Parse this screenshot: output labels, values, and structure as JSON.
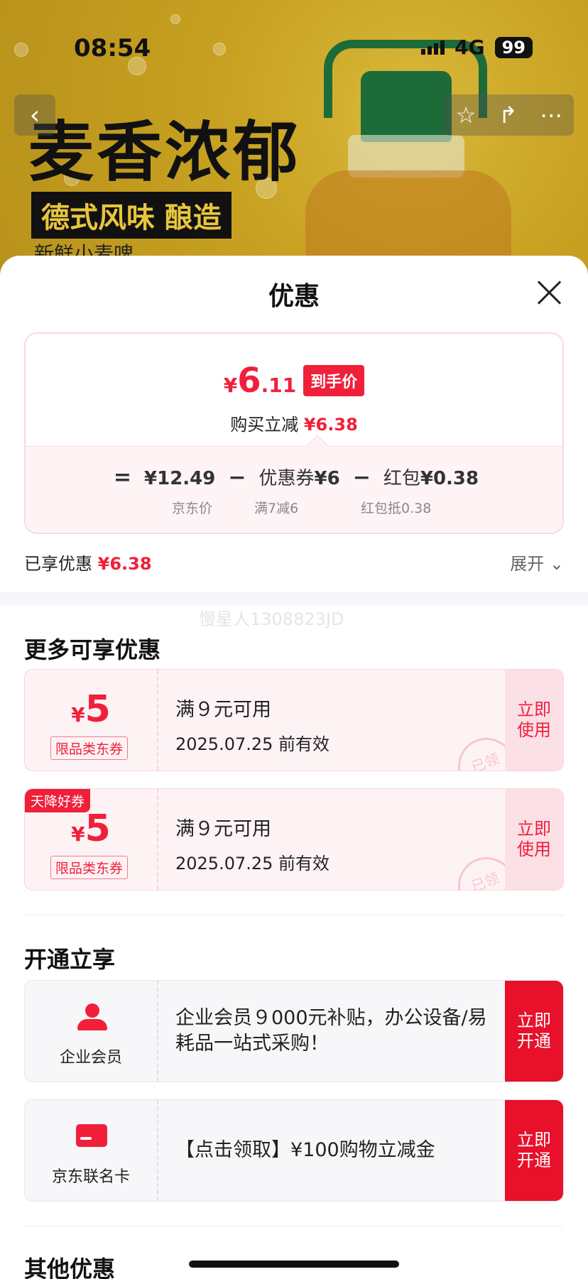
{
  "status_bar": {
    "time": "08:54",
    "network": "4G",
    "battery": "99"
  },
  "hero": {
    "title": "麦香浓郁",
    "subtitle": "德式风味 酿造",
    "subtitle2": "新鲜小麦啤"
  },
  "sheet": {
    "title": "优惠",
    "price_card": {
      "currency": "¥",
      "price_int": "6",
      "price_dec": ".11",
      "price_badge": "到手价",
      "desc_prefix": "购买立减",
      "desc_value": "¥6.38",
      "eq": "=",
      "jd_price": "¥12.49",
      "minus1": "−",
      "coupon_label": "优惠券",
      "coupon_value": "¥6",
      "minus2": "−",
      "redpacket_label": "红包",
      "redpacket_value": "¥0.38",
      "jd_price_note": "京东价",
      "coupon_note": "满7减6",
      "redpacket_note": "红包抵0.38"
    },
    "enjoyed_prefix": "已享优惠",
    "enjoyed_value": "¥6.38",
    "expand_label": "展开",
    "watermark": "慢星人1308823JD",
    "more_title": "更多可享优惠",
    "coupons": [
      {
        "currency": "¥",
        "amount": "5",
        "tag": "限品类东券",
        "condition": "满９元可用",
        "expiry": "2025.07.25 前有效",
        "action": "立即使用",
        "stamp": "已领",
        "corner": ""
      },
      {
        "currency": "¥",
        "amount": "5",
        "tag": "限品类东券",
        "condition": "满９元可用",
        "expiry": "2025.07.25 前有效",
        "action": "立即使用",
        "stamp": "已领",
        "corner": "天降好券"
      }
    ],
    "open_title": "开通立享",
    "members": [
      {
        "icon": "person-icon",
        "label": "企业会员",
        "text": "企业会员９000元补贴，办公设备/易耗品一站式采购！",
        "action": "立即开通"
      },
      {
        "icon": "credit-card-icon",
        "label": "京东联名卡",
        "text": "【点击领取】¥100购物立减金",
        "action": "立即开通"
      }
    ],
    "other_title": "其他优惠"
  },
  "colors": {
    "accent": "#f0203a",
    "coupon_bg": "#fdf3f5",
    "member_action": "#e8102a"
  }
}
